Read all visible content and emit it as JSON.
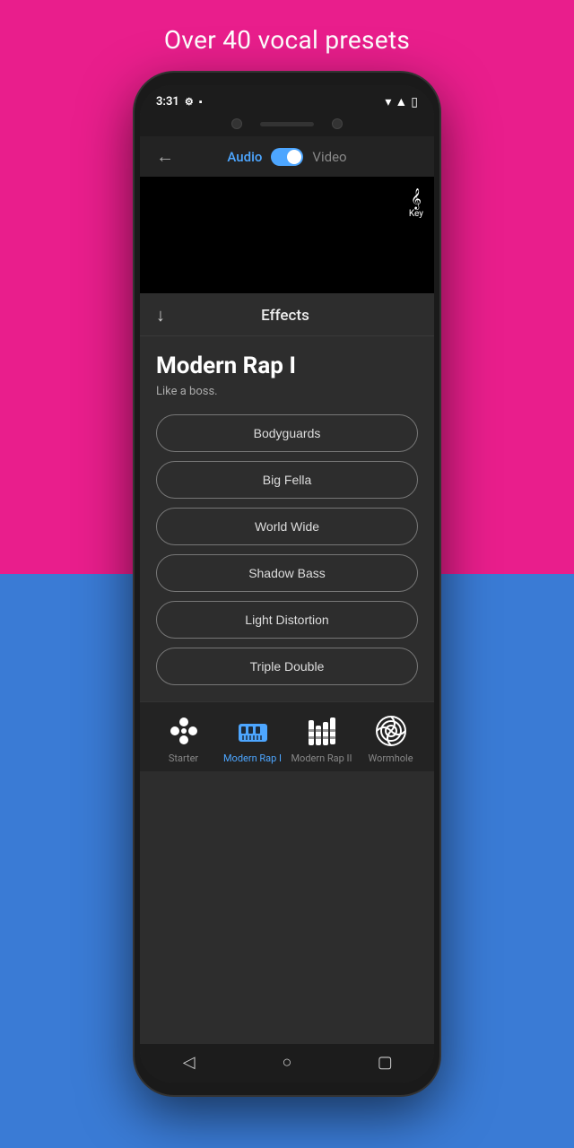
{
  "tagline": "Over 40 vocal presets",
  "app": {
    "status": {
      "time": "3:31",
      "settings_icon": "gear",
      "battery_icon": "battery"
    },
    "nav_top": {
      "back_label": "←",
      "tab_audio": "Audio",
      "tab_video": "Video"
    },
    "key_label": "Key",
    "effects_title": "Effects",
    "preset_name": "Modern Rap I",
    "preset_description": "Like a boss.",
    "effect_buttons": [
      "Bodyguards",
      "Big Fella",
      "World Wide",
      "Shadow Bass",
      "Light Distortion",
      "Triple Double"
    ],
    "bottom_tabs": [
      {
        "id": "starter",
        "label": "Starter",
        "active": false
      },
      {
        "id": "modern-rap-1",
        "label": "Modern Rap I",
        "active": true
      },
      {
        "id": "modern-rap-2",
        "label": "Modern Rap II",
        "active": false
      },
      {
        "id": "wormhole",
        "label": "Wormhole",
        "active": false
      }
    ]
  }
}
